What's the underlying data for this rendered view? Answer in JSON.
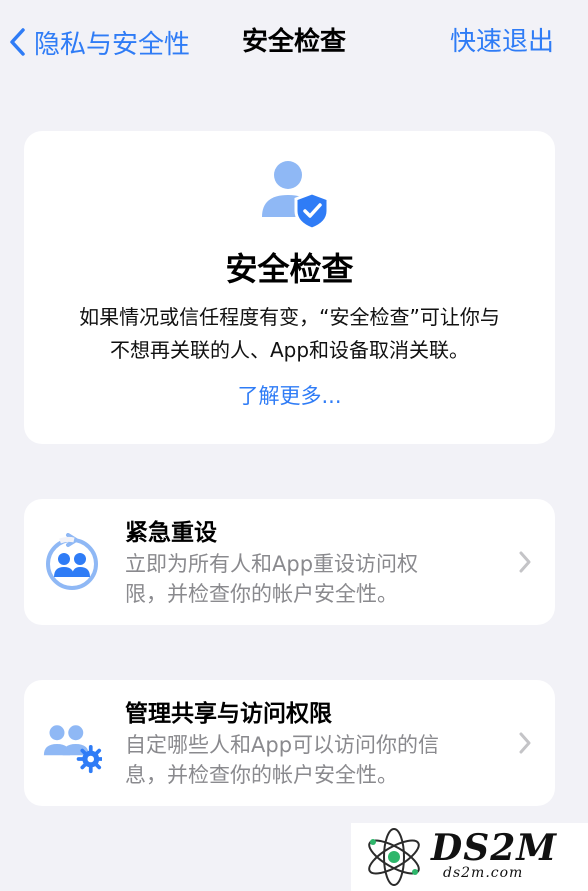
{
  "nav": {
    "back_label": "隐私与安全性",
    "title": "安全检查",
    "exit_label": "快速退出"
  },
  "hero": {
    "title": "安全检查",
    "desc_line1": "如果情况或信任程度有变，“安全检查”可让你与",
    "desc_line2": "不想再关联的人、App和设备取消关联。",
    "learn_more": "了解更多..."
  },
  "rows": [
    {
      "title": "紧急重设",
      "desc_line1": "立即为所有人和App重设访问权",
      "desc_line2": "限，并检查你的帐户安全性。"
    },
    {
      "title": "管理共享与访问权限",
      "desc_line1": "自定哪些人和App可以访问你的信",
      "desc_line2": "息，并检查你的帐户安全性。"
    }
  ],
  "watermark": {
    "text": "DS2M",
    "sub": "ds2m.com"
  },
  "colors": {
    "accent": "#2f7cf6",
    "icon_light": "#8fb8f5",
    "background": "#f2f2f7",
    "secondary_text": "#8a8a8e"
  }
}
